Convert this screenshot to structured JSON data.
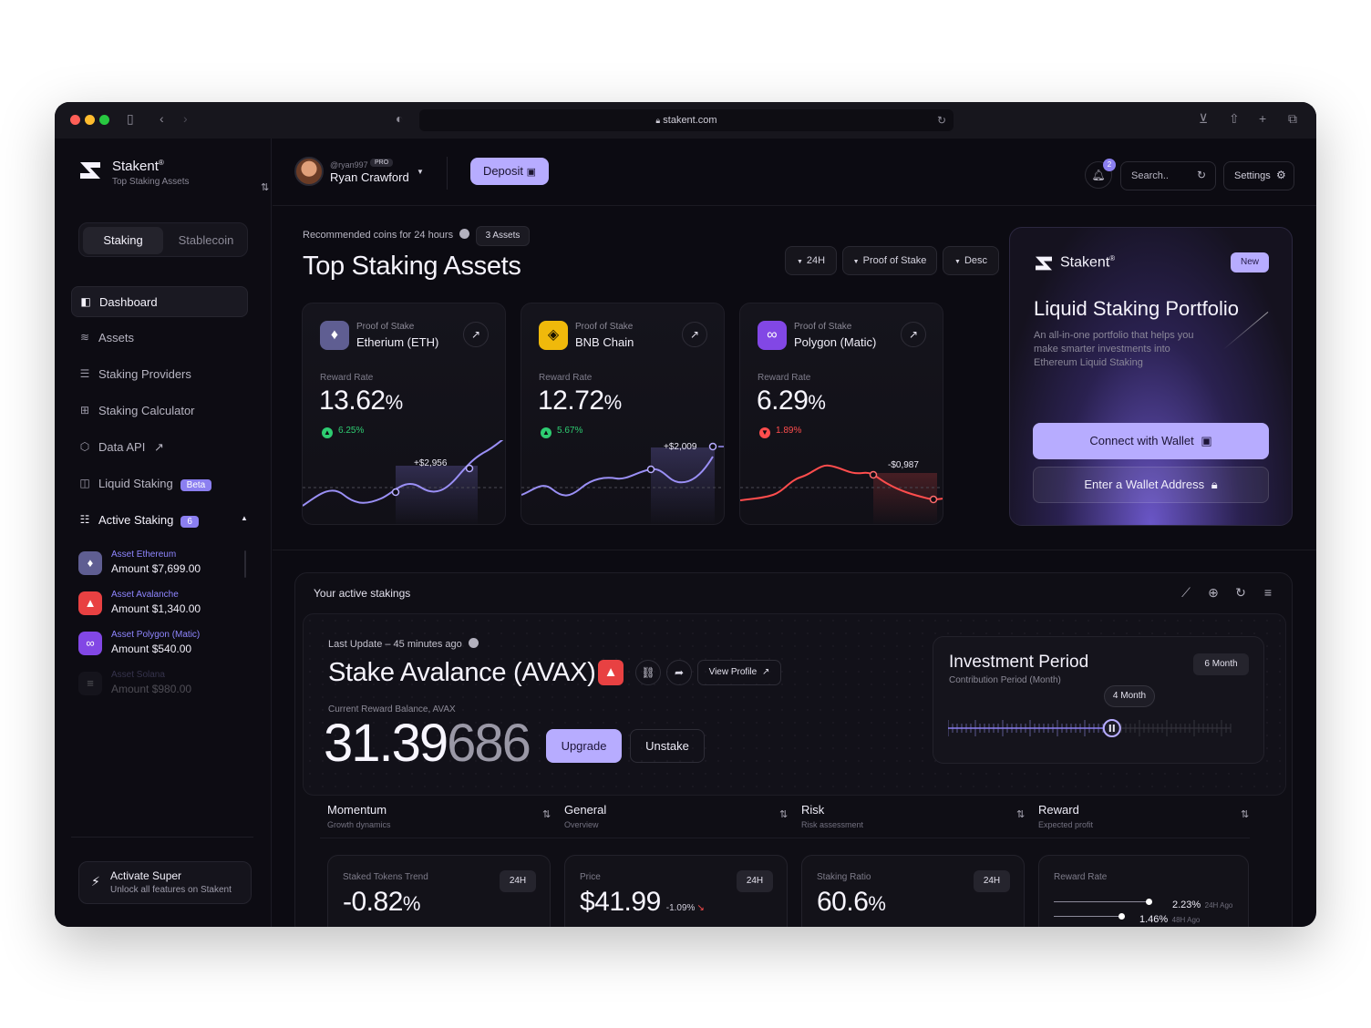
{
  "browser": {
    "url": "stakent.com"
  },
  "sidebar": {
    "brand_name": "Stakent",
    "brand_reg": "®",
    "brand_subtitle": "Top Staking Assets",
    "segment": [
      "Staking",
      "Stablecoin"
    ],
    "nav": [
      {
        "label": "Dashboard",
        "icon": "dashboard-icon"
      },
      {
        "label": "Assets",
        "icon": "layers-icon"
      },
      {
        "label": "Staking Providers",
        "icon": "server-icon"
      },
      {
        "label": "Staking Calculator",
        "icon": "calculator-icon"
      },
      {
        "label": "Data API",
        "icon": "cube-icon",
        "suffix": "↗"
      },
      {
        "label": "Liquid Staking",
        "icon": "droplet-icon",
        "badge": "Beta"
      },
      {
        "label": "Active Staking",
        "icon": "stack-icon",
        "badge": "6"
      }
    ],
    "assets": [
      {
        "name": "Asset Ethereum",
        "amount": "Amount $7,699.00"
      },
      {
        "name": "Asset Avalanche",
        "amount": "Amount $1,340.00"
      },
      {
        "name": "Asset Polygon (Matic)",
        "amount": "Amount $540.00"
      },
      {
        "name": "Asset Solana",
        "amount": "Amount $980.00"
      }
    ],
    "activate_title": "Activate Super",
    "activate_sub": "Unlock all features on Stakent"
  },
  "topbar": {
    "user_handle": "@ryan997",
    "user_badge": "PRO",
    "user_name": "Ryan Crawford",
    "deposit_label": "Deposit",
    "notif_count": "2",
    "search_placeholder": "Search..",
    "settings_label": "Settings"
  },
  "top": {
    "recommended": "Recommended coins for 24 hours",
    "assets_count": "3 Assets",
    "title": "Top Staking Assets",
    "filters": [
      "24H",
      "Proof of Stake",
      "Desc"
    ]
  },
  "coins": [
    {
      "type": "Proof of Stake",
      "name": "Etherium (ETH)",
      "rate_label": "Reward Rate",
      "rate": "13.62",
      "pct": "%",
      "change": "6.25%",
      "change_dir": "up",
      "spark_label": "+$2,956",
      "icon": "ethereum-icon",
      "color": "#5f5e92"
    },
    {
      "type": "Proof of Stake",
      "name": "BNB Chain",
      "rate_label": "Reward Rate",
      "rate": "12.72",
      "pct": "%",
      "change": "5.67%",
      "change_dir": "up",
      "spark_label": "+$2,009",
      "icon": "bnb-icon",
      "color": "#f0b90b"
    },
    {
      "type": "Proof of Stake",
      "name": "Polygon (Matic)",
      "rate_label": "Reward Rate",
      "rate": "6.29",
      "pct": "%",
      "change": "1.89%",
      "change_dir": "down",
      "spark_label": "-$0,987",
      "icon": "polygon-icon",
      "color": "#8247e5"
    }
  ],
  "portfolio": {
    "brand": "Stakent",
    "brand_reg": "®",
    "new_label": "New",
    "title": "Liquid Staking Portfolio",
    "desc": "An all-in-one portfolio that helps you make smarter investments into Ethereum Liquid Staking",
    "btn_connect": "Connect with Wallet",
    "btn_enter": "Enter a Wallet Address"
  },
  "active": {
    "title": "Your active stakings",
    "last_update": "Last Update – 45 minutes ago",
    "stake_title": "Stake Avalance (AVAX)",
    "view_profile": "View Profile",
    "balance_label": "Current Reward Balance, AVAX",
    "balance_main": "31.39",
    "balance_fade": "686",
    "upgrade": "Upgrade",
    "unstake": "Unstake",
    "investment": {
      "title": "Investment Period",
      "subtitle": "Contribution Period (Month)",
      "pill": "6 Month",
      "tooltip": "4 Month",
      "slider_fraction": 0.58
    },
    "tabs": [
      {
        "name": "Momentum",
        "sub": "Growth dynamics"
      },
      {
        "name": "General",
        "sub": "Overview"
      },
      {
        "name": "Risk",
        "sub": "Risk assessment"
      },
      {
        "name": "Reward",
        "sub": "Expected profit"
      }
    ],
    "cards": [
      {
        "label": "Staked Tokens Trend",
        "pill": "24H",
        "value": "-0.82",
        "unit": "%"
      },
      {
        "label": "Price",
        "pill": "24H",
        "value": "$41.99",
        "change": "-1.09%"
      },
      {
        "label": "Staking Ratio",
        "pill": "24H",
        "value": "60.6",
        "unit": "%"
      },
      {
        "label": "Reward Rate",
        "r1": "2.23%",
        "r1_sub": "24H Ago",
        "r2": "1.46%",
        "r2_sub": "48H Ago"
      }
    ]
  },
  "colors": {
    "accent": "#b7acff",
    "positive": "#2ecc71",
    "negative": "#ff4d4d",
    "bg": "#0c0b12"
  }
}
